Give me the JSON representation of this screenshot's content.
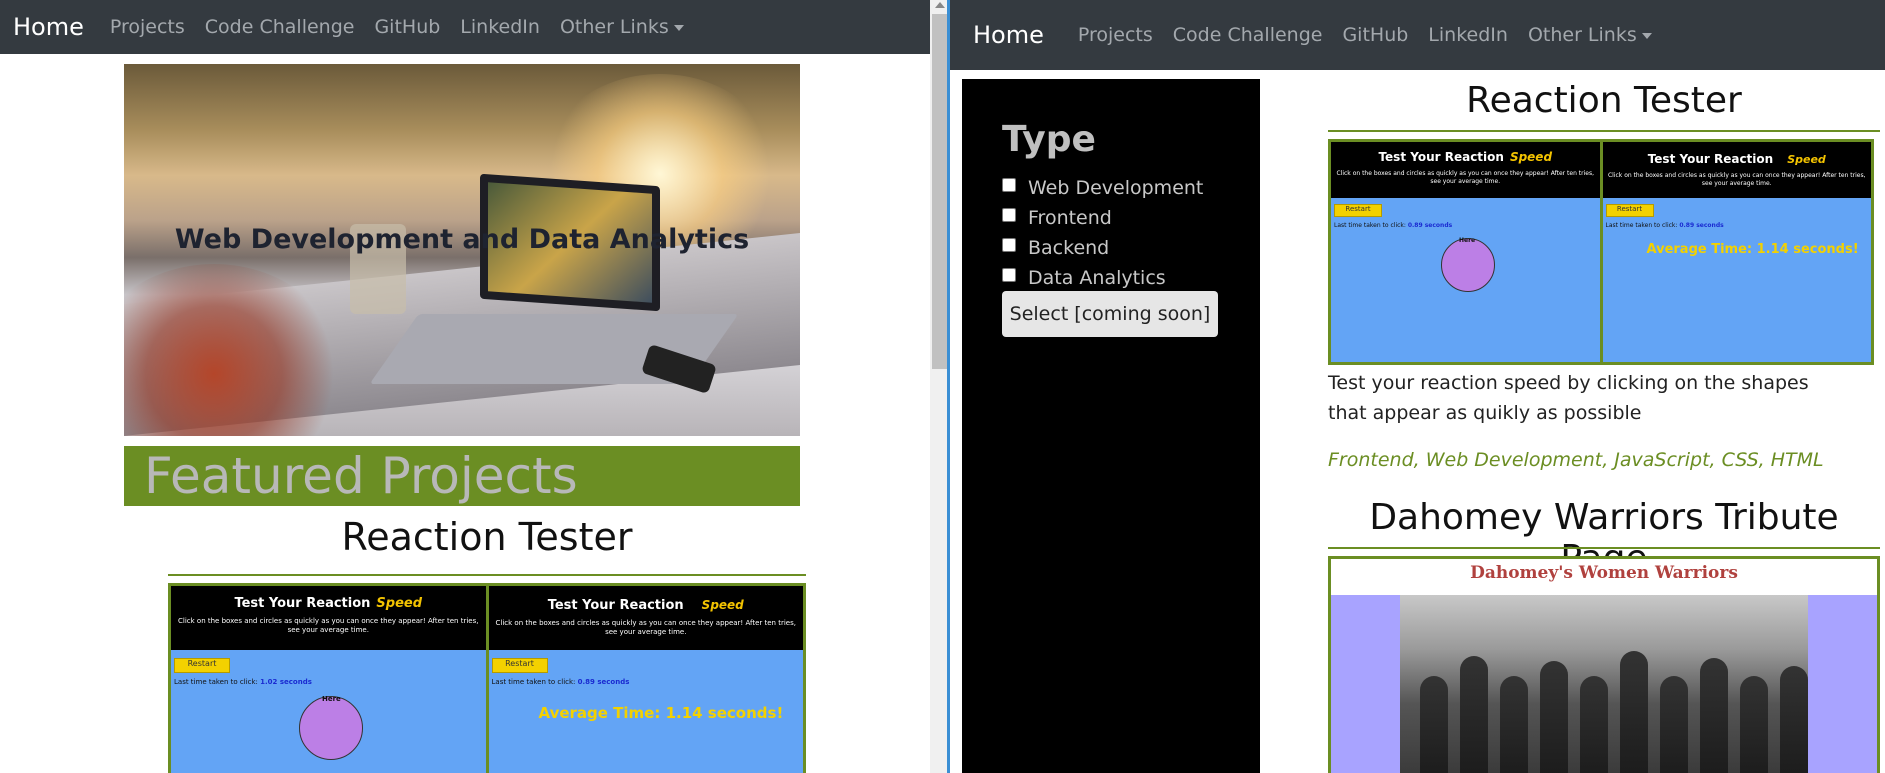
{
  "nav": {
    "brand": "Home",
    "links": [
      "Projects",
      "Code Challenge",
      "GitHub",
      "LinkedIn"
    ],
    "dropdown": "Other Links"
  },
  "left": {
    "hero_title": "Web Development and Data Analytics",
    "featured_heading": "Featured Projects",
    "project_title": "Reaction Tester"
  },
  "reaction_image": {
    "heading": "Test Your Reaction",
    "heading_em": "Speed",
    "instructions": "Click on the boxes and circles as quickly as you can once they appear! After ten tries, see your average time.",
    "restart": "Restart",
    "last_time_label": "Last time taken to click:",
    "last_time_left": "1.02 seconds",
    "last_time_right": "0.89 seconds",
    "shape_label": "Here",
    "average": "Average Time: 1.14 seconds!"
  },
  "sidebar": {
    "heading": "Type",
    "filters": [
      "Web Development",
      "Frontend",
      "Backend",
      "Data Analytics"
    ],
    "button": "Select [coming soon]"
  },
  "projects": [
    {
      "title": "Reaction Tester",
      "description": "Test your reaction speed by clicking on the shapes that appear as quikly as possible",
      "tags": "Frontend, Web Development, JavaScript, CSS, HTML"
    },
    {
      "title": "Dahomey Warriors Tribute Page",
      "image_heading": "Dahomey's Women Warriors"
    }
  ],
  "colors": {
    "navbar": "#343a40",
    "accent_green": "#6b8e23",
    "sidebar_bg": "#000000",
    "rt_blue": "#63a4f5",
    "rt_yellow": "#f3d100"
  }
}
